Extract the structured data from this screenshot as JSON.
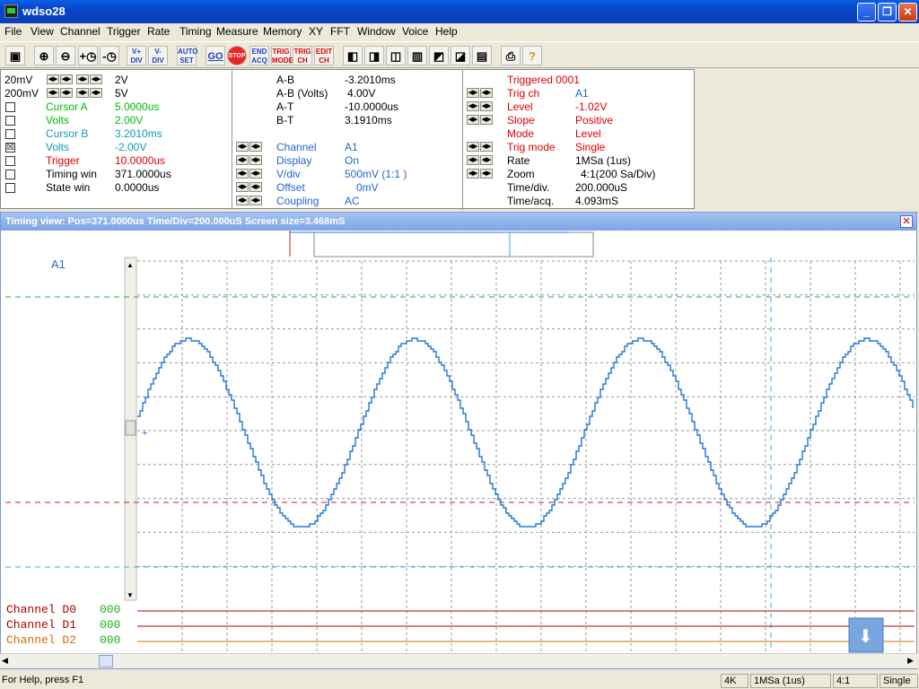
{
  "window": {
    "title": "wdso28"
  },
  "menu": [
    "File",
    "View",
    "Channel",
    "Trigger",
    "Rate",
    "Timing",
    "Measure",
    "Memory",
    "XY",
    "FFT",
    "Window",
    "Voice",
    "Help"
  ],
  "toolbar": {
    "vplus": "V+\nDIV",
    "vminus": "V-\nDIV",
    "autoset": "AUTO\nSET",
    "go": "GO",
    "stop": "STOP",
    "endacq": "END\nACQ",
    "trigmode": "TRIG\nMODE",
    "trigch": "TRIG\nCH",
    "editch": "EDIT\nCH"
  },
  "left_panel": {
    "ch1_vdiv": "20mV",
    "ch1_range": "2V",
    "ch2_vdiv": "200mV",
    "ch2_range": "5V",
    "cursor_a_label": "Cursor A",
    "cursor_a_val": "5.0000us",
    "volts_a_label": "Volts",
    "volts_a_val": "2.00V",
    "cursor_b_label": "Cursor B",
    "cursor_b_val": "3.2010ms",
    "volts_b_label": "Volts",
    "volts_b_val": "-2.00V",
    "trigger_label": "Trigger",
    "trigger_val": "10.0000us",
    "timing_win_label": "Timing win",
    "timing_win_val": "371.0000us",
    "state_win_label": "State win",
    "state_win_val": "0.0000us",
    "volts_b_checked": "☒"
  },
  "mid_panel": {
    "ab_label": "A-B",
    "ab_val": "-3.2010ms",
    "abv_label": "A-B (Volts)",
    "abv_val": "4.00V",
    "at_label": "A-T",
    "at_val": "-10.0000us",
    "bt_label": "B-T",
    "bt_val": "3.1910ms",
    "channel_label": "Channel",
    "channel_val": "A1",
    "display_label": "Display",
    "display_val": "On",
    "vdiv_label": "V/div",
    "vdiv_val": "500mV (1:1   )",
    "offset_label": "Offset",
    "offset_val": "0mV",
    "coupling_label": "Coupling",
    "coupling_val": "AC"
  },
  "right_panel": {
    "triggered": "Triggered 0001",
    "trigch_label": "Trig ch",
    "trigch_val": "A1",
    "level_label": "Level",
    "level_val": "-1.02V",
    "slope_label": "Slope",
    "slope_val": "Positive",
    "mode_label": "Mode",
    "mode_val": "Level",
    "trigmode_label": "Trig mode",
    "trigmode_val": "Single",
    "rate_label": "Rate",
    "rate_val": "1MSa (1us)",
    "zoom_label": "Zoom",
    "zoom_val": "4:1(200 Sa/Div)",
    "timediv_label": "Time/div.",
    "timediv_val": "200.000uS",
    "timeacq_label": "Time/acq.",
    "timeacq_val": "4.093mS"
  },
  "timing_view": {
    "header": "Timing view: Pos=371.0000us Time/Div=200.000uS Screen size=3.468mS",
    "channel_label": "A1",
    "digital": [
      {
        "name": "Channel D0",
        "value": "000",
        "color": "#b00000"
      },
      {
        "name": "Channel D1",
        "value": "000",
        "color": "#b00000"
      },
      {
        "name": "Channel D2",
        "value": "000",
        "color": "#d07000"
      }
    ],
    "colors": {
      "wave": "#1f78d8",
      "cursor_a": "#2ab040",
      "trigger": "#c02020",
      "cursor_b": "#30b0d8"
    }
  },
  "status": {
    "help": "For Help, press F1",
    "mem": "4K",
    "rate": "1MSa (1us)",
    "zoom": "4:1",
    "mode": "Single"
  }
}
